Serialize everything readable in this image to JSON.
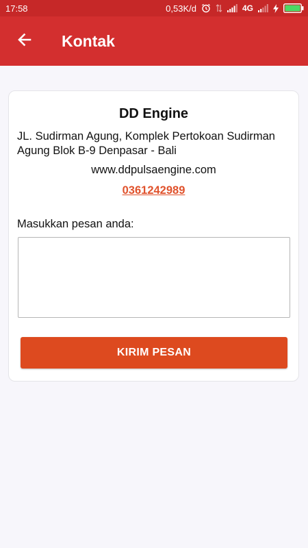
{
  "status_bar": {
    "time": "17:58",
    "network_speed": "0,53K/d",
    "network_type": "4G",
    "icons": [
      "alarm-icon",
      "data-arrows-icon",
      "signal-icon",
      "signal-icon",
      "charging-icon",
      "battery-icon"
    ]
  },
  "app_bar": {
    "title": "Kontak",
    "back_icon": "arrow-left-icon"
  },
  "contact": {
    "name": "DD Engine",
    "address": "JL. Sudirman Agung, Komplek Pertokoan Sudirman Agung Blok B-9 Denpasar - Bali",
    "website": "www.ddpulsaengine.com",
    "phone": "0361242989"
  },
  "form": {
    "message_label": "Masukkan pesan anda:",
    "message_value": "",
    "send_label": "KIRIM PESAN"
  },
  "colors": {
    "status_bar": "#c62828",
    "app_bar": "#d32f2f",
    "accent": "#dd4a1f",
    "phone_link": "#e0522c",
    "background": "#f7f6fb"
  }
}
